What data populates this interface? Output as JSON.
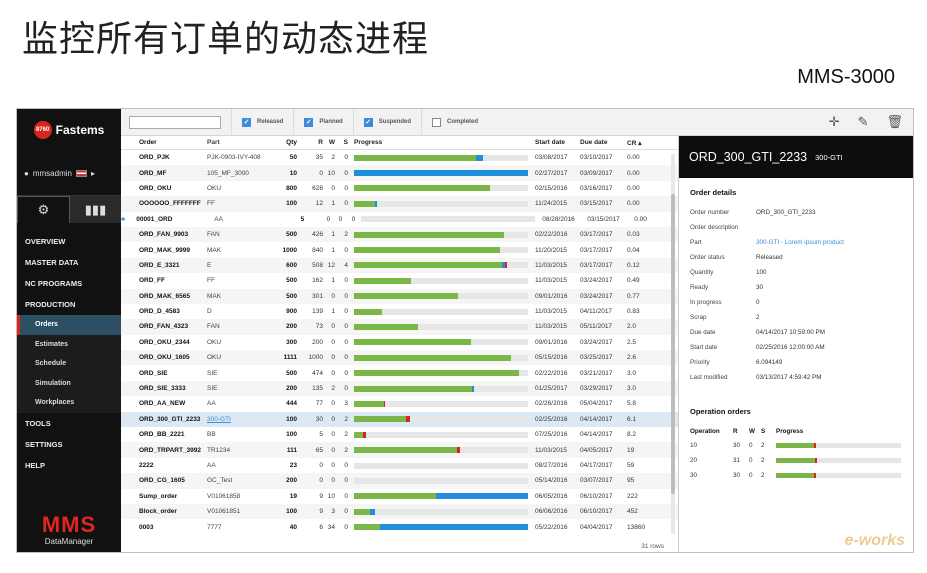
{
  "slide": {
    "title": "监控所有订单的动态进程",
    "subtitle": "MMS-3000"
  },
  "sidebar": {
    "logo_badge": "8760",
    "logo_text": "Fastems",
    "user": "mmsadmin",
    "nav": [
      {
        "label": "OVERVIEW",
        "type": "section"
      },
      {
        "label": "MASTER DATA",
        "type": "section"
      },
      {
        "label": "NC PROGRAMS",
        "type": "section"
      },
      {
        "label": "PRODUCTION",
        "type": "section"
      },
      {
        "label": "Orders",
        "type": "sub",
        "active": true
      },
      {
        "label": "Estimates",
        "type": "sub"
      },
      {
        "label": "Schedule",
        "type": "sub"
      },
      {
        "label": "Simulation",
        "type": "sub"
      },
      {
        "label": "Workplaces",
        "type": "sub"
      },
      {
        "label": "TOOLS",
        "type": "section"
      },
      {
        "label": "SETTINGS",
        "type": "section"
      },
      {
        "label": "HELP",
        "type": "section"
      }
    ],
    "brand_big": "MMS",
    "brand_small": "DataManager"
  },
  "toolbar": {
    "filters": [
      {
        "label": "Released",
        "checked": true
      },
      {
        "label": "Planned",
        "checked": true
      },
      {
        "label": "Suspended",
        "checked": true
      },
      {
        "label": "Completed",
        "checked": false
      }
    ]
  },
  "table": {
    "columns": {
      "order": "Order",
      "part": "Part",
      "qty": "Qty",
      "r": "R",
      "w": "W",
      "s": "S",
      "progress": "Progress",
      "start": "Start date",
      "due": "Due date",
      "cr": "CR ▴"
    },
    "rows": [
      {
        "order": "ORD_PJK",
        "part": "PJK-0903-IVY-408",
        "qty": "50",
        "r": "35",
        "w": "2",
        "s": "0",
        "green": 0.7,
        "blue": 0.04,
        "red": 0,
        "start": "03/08/2017",
        "due": "03/10/2017",
        "cr": "0.00"
      },
      {
        "order": "ORD_MF",
        "part": "105_MF_3000",
        "qty": "10",
        "r": "0",
        "w": "10",
        "s": "0",
        "green": 0,
        "blue": 1.0,
        "red": 0,
        "start": "02/27/2017",
        "due": "03/09/2017",
        "cr": "0.00"
      },
      {
        "order": "ORD_OKU",
        "part": "OKU",
        "qty": "800",
        "r": "628",
        "w": "0",
        "s": "0",
        "green": 0.78,
        "blue": 0,
        "red": 0,
        "start": "02/15/2016",
        "due": "03/16/2017",
        "cr": "0.00"
      },
      {
        "order": "OOOOOO_FFFFFFF",
        "part": "FF",
        "qty": "100",
        "r": "12",
        "w": "1",
        "s": "0",
        "green": 0.12,
        "blue": 0.01,
        "red": 0,
        "start": "11/24/2015",
        "due": "03/15/2017",
        "cr": "0.00"
      },
      {
        "order": "00001_ORD",
        "part": "AA",
        "qty": "5",
        "r": "0",
        "w": "0",
        "s": "0",
        "green": 0,
        "blue": 0,
        "red": 0,
        "start": "08/28/2016",
        "due": "03/15/2017",
        "cr": "0.00",
        "icon": true
      },
      {
        "order": "ORD_FAN_9903",
        "part": "FAN",
        "qty": "500",
        "r": "426",
        "w": "1",
        "s": "2",
        "green": 0.86,
        "blue": 0,
        "red": 0,
        "start": "02/22/2016",
        "due": "03/17/2017",
        "cr": "0.03"
      },
      {
        "order": "ORD_MAK_9999",
        "part": "MAK",
        "qty": "1000",
        "r": "840",
        "w": "1",
        "s": "0",
        "green": 0.84,
        "blue": 0,
        "red": 0,
        "start": "11/20/2015",
        "due": "03/17/2017",
        "cr": "0.04"
      },
      {
        "order": "ORD_E_3321",
        "part": "E",
        "qty": "600",
        "r": "508",
        "w": "12",
        "s": "4",
        "green": 0.85,
        "blue": 0.02,
        "red": 0.01,
        "start": "11/03/2015",
        "due": "03/17/2017",
        "cr": "0.12"
      },
      {
        "order": "ORD_FF",
        "part": "FF",
        "qty": "500",
        "r": "162",
        "w": "1",
        "s": "0",
        "green": 0.33,
        "blue": 0,
        "red": 0,
        "start": "11/03/2015",
        "due": "03/24/2017",
        "cr": "0.49"
      },
      {
        "order": "ORD_MAK_6565",
        "part": "MAK",
        "qty": "500",
        "r": "301",
        "w": "0",
        "s": "0",
        "green": 0.6,
        "blue": 0,
        "red": 0,
        "start": "09/01/2016",
        "due": "03/24/2017",
        "cr": "0.77"
      },
      {
        "order": "ORD_D_4583",
        "part": "D",
        "qty": "900",
        "r": "139",
        "w": "1",
        "s": "0",
        "green": 0.16,
        "blue": 0,
        "red": 0,
        "start": "11/03/2015",
        "due": "04/11/2017",
        "cr": "0.83"
      },
      {
        "order": "ORD_FAN_4323",
        "part": "FAN",
        "qty": "200",
        "r": "73",
        "w": "0",
        "s": "0",
        "green": 0.37,
        "blue": 0,
        "red": 0,
        "start": "11/03/2015",
        "due": "05/11/2017",
        "cr": "2.0"
      },
      {
        "order": "ORD_OKU_2344",
        "part": "OKU",
        "qty": "300",
        "r": "200",
        "w": "0",
        "s": "0",
        "green": 0.67,
        "blue": 0,
        "red": 0,
        "start": "09/01/2016",
        "due": "03/24/2017",
        "cr": "2.5"
      },
      {
        "order": "ORD_OKU_1605",
        "part": "OKU",
        "qty": "1111",
        "r": "1000",
        "w": "0",
        "s": "0",
        "green": 0.9,
        "blue": 0,
        "red": 0,
        "start": "05/15/2016",
        "due": "03/25/2017",
        "cr": "2.6"
      },
      {
        "order": "ORD_SIE",
        "part": "SIE",
        "qty": "500",
        "r": "474",
        "w": "0",
        "s": "0",
        "green": 0.95,
        "blue": 0,
        "red": 0,
        "start": "02/22/2016",
        "due": "03/21/2017",
        "cr": "3.0"
      },
      {
        "order": "ORD_SIE_3333",
        "part": "SIE",
        "qty": "200",
        "r": "135",
        "w": "2",
        "s": "0",
        "green": 0.68,
        "blue": 0.01,
        "red": 0,
        "start": "01/25/2017",
        "due": "03/29/2017",
        "cr": "3.0"
      },
      {
        "order": "ORD_AA_NEW",
        "part": "AA",
        "qty": "444",
        "r": "77",
        "w": "0",
        "s": "3",
        "green": 0.17,
        "blue": 0,
        "red": 0.01,
        "start": "02/26/2016",
        "due": "05/04/2017",
        "cr": "5.8"
      },
      {
        "order": "ORD_300_GTI_2233",
        "part": "300-GTI",
        "qty": "100",
        "r": "30",
        "w": "0",
        "s": "2",
        "green": 0.3,
        "blue": 0,
        "red": 0.02,
        "start": "02/25/2016",
        "due": "04/14/2017",
        "cr": "6.1",
        "selected": true
      },
      {
        "order": "ORD_BB_2221",
        "part": "BB",
        "qty": "100",
        "r": "5",
        "w": "0",
        "s": "2",
        "green": 0.05,
        "blue": 0,
        "red": 0.02,
        "start": "07/25/2016",
        "due": "04/14/2017",
        "cr": "8.2"
      },
      {
        "order": "ORD_TRPART_3992",
        "part": "TR1234",
        "qty": "111",
        "r": "65",
        "w": "0",
        "s": "2",
        "green": 0.59,
        "blue": 0,
        "red": 0.02,
        "start": "11/03/2015",
        "due": "04/05/2017",
        "cr": "19"
      },
      {
        "order": "2222",
        "part": "AA",
        "qty": "23",
        "r": "0",
        "w": "0",
        "s": "0",
        "green": 0,
        "blue": 0,
        "red": 0,
        "start": "08/27/2016",
        "due": "04/17/2017",
        "cr": "59"
      },
      {
        "order": "ORD_CG_1605",
        "part": "GC_Test",
        "qty": "200",
        "r": "0",
        "w": "0",
        "s": "0",
        "green": 0,
        "blue": 0,
        "red": 0,
        "start": "05/14/2016",
        "due": "03/07/2017",
        "cr": "95"
      },
      {
        "order": "Sump_order",
        "part": "V01061858",
        "qty": "19",
        "r": "9",
        "w": "10",
        "s": "0",
        "green": 0.47,
        "blue": 0.53,
        "red": 0,
        "start": "06/05/2016",
        "due": "06/10/2017",
        "cr": "222"
      },
      {
        "order": "Block_order",
        "part": "V01061851",
        "qty": "100",
        "r": "9",
        "w": "3",
        "s": "0",
        "green": 0.09,
        "blue": 0.03,
        "red": 0,
        "start": "06/06/2016",
        "due": "06/10/2017",
        "cr": "452"
      },
      {
        "order": "0003",
        "part": "7777",
        "qty": "40",
        "r": "6",
        "w": "34",
        "s": "0",
        "green": 0.15,
        "blue": 0.85,
        "red": 0,
        "start": "05/22/2016",
        "due": "04/04/2017",
        "cr": "13860"
      }
    ],
    "row_count": "31 rows"
  },
  "detail": {
    "title": "ORD_300_GTI_2233",
    "badge": "300-GTI",
    "section": "Order details",
    "fields": [
      {
        "k": "Order number",
        "v": "ORD_300_GTI_2233"
      },
      {
        "k": "Order description",
        "v": ""
      },
      {
        "k": "Part",
        "v": "300-GTI - Lorem ipsum product",
        "link": true
      },
      {
        "k": "Order status",
        "v": "Released"
      },
      {
        "k": "Quantity",
        "v": "100"
      },
      {
        "k": "Ready",
        "v": "30"
      },
      {
        "k": "In progress",
        "v": "0"
      },
      {
        "k": "Scrap",
        "v": "2"
      },
      {
        "k": "Due date",
        "v": "04/14/2017 10:59:00 PM"
      },
      {
        "k": "Start date",
        "v": "02/25/2016 12:00:00 AM"
      },
      {
        "k": "Priority",
        "v": "6.094149"
      },
      {
        "k": "Last modified",
        "v": "03/13/2017 4:59:42 PM"
      }
    ],
    "op_section": "Operation orders",
    "op_columns": {
      "op": "Operation",
      "r": "R",
      "w": "W",
      "s": "S",
      "p": "Progress"
    },
    "ops": [
      {
        "op": "10",
        "r": "30",
        "w": "0",
        "s": "2",
        "green": 0.3,
        "red": 0.02
      },
      {
        "op": "20",
        "r": "31",
        "w": "0",
        "s": "2",
        "green": 0.31,
        "red": 0.02
      },
      {
        "op": "30",
        "r": "30",
        "w": "0",
        "s": "2",
        "green": 0.3,
        "red": 0.02
      }
    ]
  },
  "watermark": "e-works",
  "colors": {
    "green": "#7ab648",
    "blue": "#1e8fd8",
    "red": "#d8261f",
    "accent": "#3b8bd6"
  }
}
